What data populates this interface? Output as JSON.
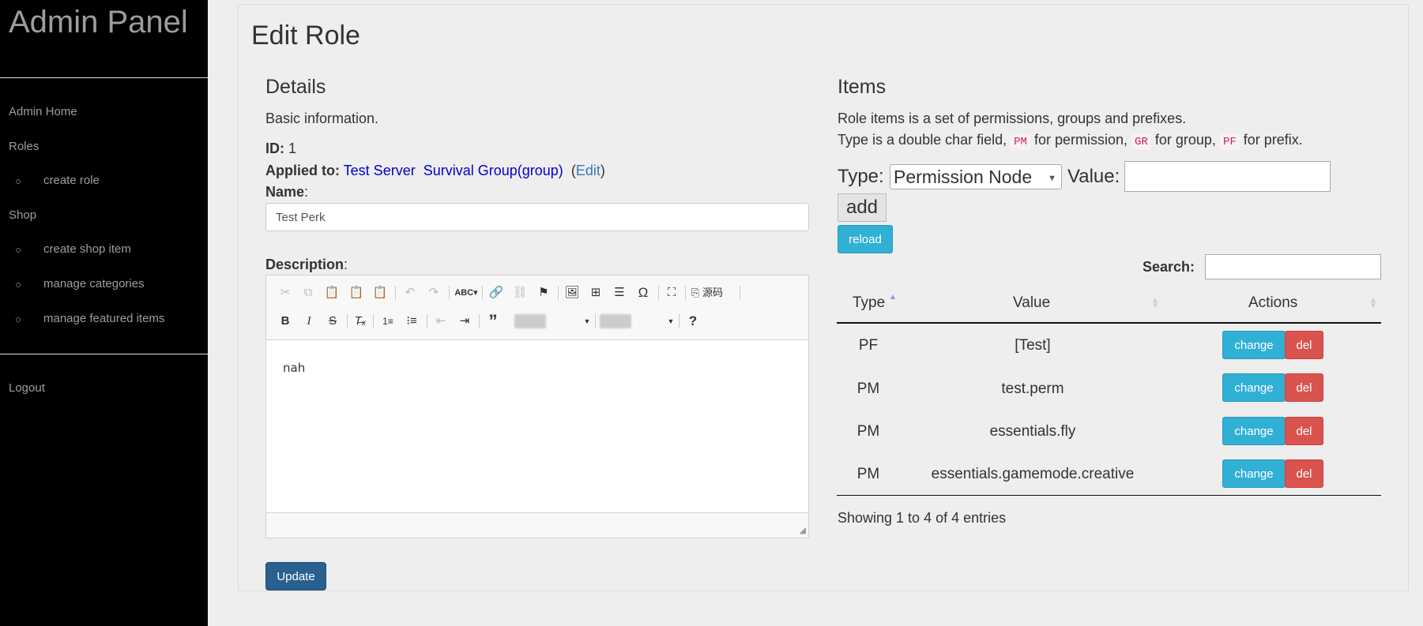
{
  "sidebar": {
    "brand": "Admin Panel",
    "admin_home": "Admin Home",
    "roles": "Roles",
    "create_role": "create role",
    "shop": "Shop",
    "create_shop_item": "create shop item",
    "manage_categories": "manage categories",
    "manage_featured_items": "manage featured items",
    "logout": "Logout"
  },
  "page": {
    "title": "Edit Role"
  },
  "details": {
    "heading": "Details",
    "subtitle": "Basic information.",
    "id_label": "ID:",
    "id_value": "1",
    "applied_label": "Applied to:",
    "applied_server": "Test Server",
    "applied_group": "Survival Group(group)",
    "edit_paren_open": "(",
    "edit_link": "Edit",
    "edit_paren_close": ")",
    "name_label": "Name",
    "name_colon": ":",
    "name_value": "Test Perk",
    "description_label": "Description",
    "description_colon": ":",
    "description_content": "nah",
    "source_label": "源码",
    "update_button": "Update"
  },
  "items": {
    "heading": "Items",
    "intro": "Role items is a set of permissions, groups and prefixes.",
    "type_text_1": "Type is a double char field,",
    "code_pm": "PM",
    "type_text_2": "for permission,",
    "code_gr": "GR",
    "type_text_3": "for group,",
    "code_pf": "PF",
    "type_text_4": "for prefix.",
    "type_label": "Type:",
    "type_selected": "Permission Node",
    "value_label": "Value:",
    "add_button": "add",
    "reload_button": "reload",
    "search_label": "Search:",
    "columns": [
      "Type",
      "Value",
      "Actions"
    ],
    "rows": [
      {
        "type": "PF",
        "value": "[Test]"
      },
      {
        "type": "PM",
        "value": "test.perm"
      },
      {
        "type": "PM",
        "value": "essentials.fly"
      },
      {
        "type": "PM",
        "value": "essentials.gamemode.creative"
      }
    ],
    "change_label": "change",
    "del_label": "del",
    "footer": "Showing 1 to 4 of 4 entries"
  }
}
